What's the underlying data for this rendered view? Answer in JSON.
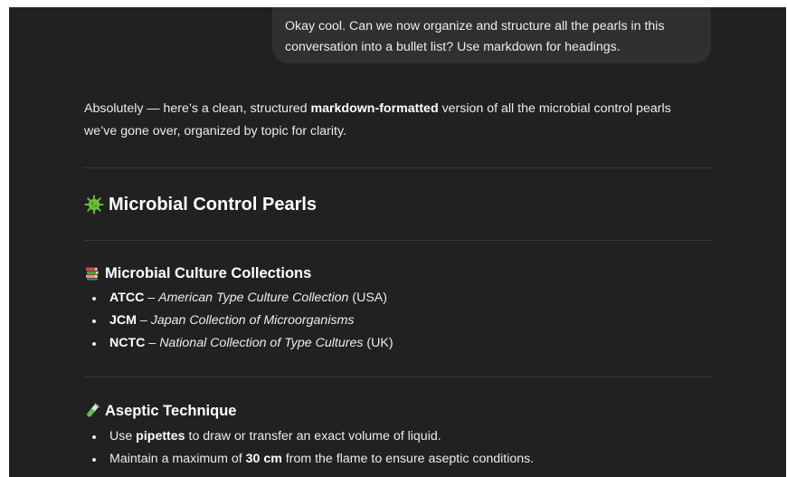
{
  "user_message": {
    "line1": "Okay cool. Can we now organize and structure all the pearls in this",
    "line2": "conversation into a bullet list? Use markdown for headings."
  },
  "assistant": {
    "intro_part1": "Absolutely — here’s a clean, structured ",
    "intro_bold": "markdown-formatted",
    "intro_part2": " version of all the microbial control pearls",
    "intro_line2": "we’ve gone over, organized by topic for clarity.",
    "main_heading": "Microbial Control Pearls",
    "main_heading_icon": "microbe-icon",
    "sections": [
      {
        "heading": "Microbial Culture Collections",
        "icon": "books-icon",
        "items": [
          {
            "abbr": "ATCC",
            "sep": " – ",
            "name": "American Type Culture Collection",
            "suffix": " (USA)"
          },
          {
            "abbr": "JCM",
            "sep": " – ",
            "name": "Japan Collection of Microorganisms",
            "suffix": ""
          },
          {
            "abbr": "NCTC",
            "sep": " – ",
            "name": "National Collection of Type Cultures",
            "suffix": " (UK)"
          }
        ]
      },
      {
        "heading": "Aseptic Technique",
        "icon": "test-tube-icon",
        "items": [
          {
            "pre": "Use ",
            "bold": "pipettes",
            "post": " to draw or transfer an exact volume of liquid."
          },
          {
            "pre": "Maintain a maximum of ",
            "bold": "30 cm",
            "post": " from the flame to ensure aseptic conditions."
          }
        ]
      }
    ]
  },
  "colors": {
    "background": "#212121",
    "user_bubble": "#303030",
    "text": "#ececec",
    "divider": "#3a3a3a",
    "microbe_icon": "#6bbf3a",
    "test_tube_icon": "#5cc04a"
  }
}
